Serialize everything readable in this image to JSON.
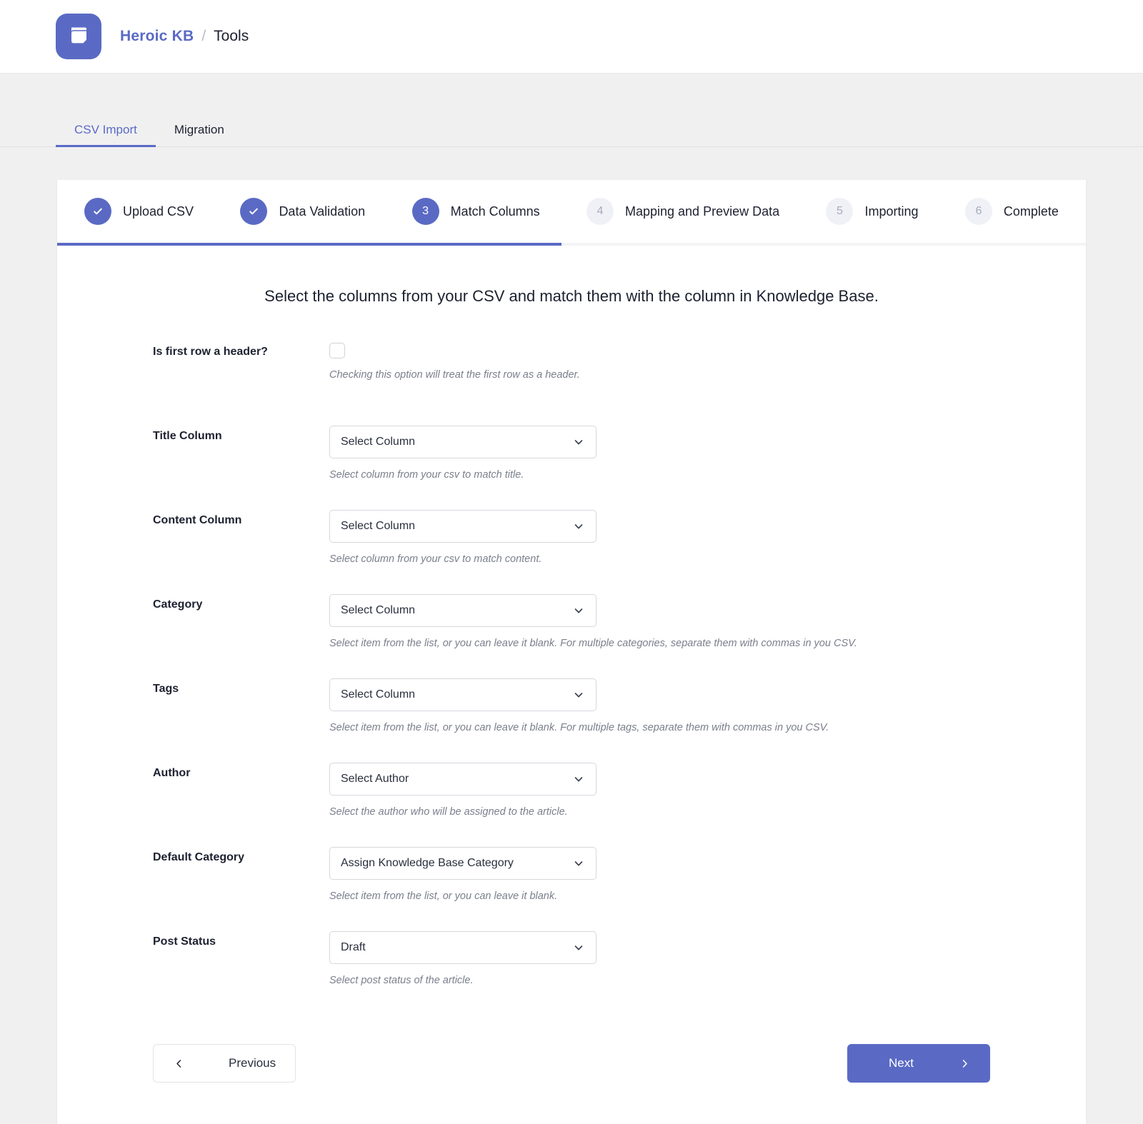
{
  "header": {
    "logo_icon": "book-icon",
    "brand": "Heroic KB",
    "separator": "/",
    "page": "Tools"
  },
  "tabs": [
    {
      "label": "CSV Import",
      "active": true
    },
    {
      "label": "Migration",
      "active": false
    }
  ],
  "stepper": {
    "progress_percent": 49,
    "steps": [
      {
        "num": "1",
        "label": "Upload CSV",
        "state": "done"
      },
      {
        "num": "2",
        "label": "Data Validation",
        "state": "done"
      },
      {
        "num": "3",
        "label": "Match Columns",
        "state": "current"
      },
      {
        "num": "4",
        "label": "Mapping and Preview Data",
        "state": "todo"
      },
      {
        "num": "5",
        "label": "Importing",
        "state": "todo"
      },
      {
        "num": "6",
        "label": "Complete",
        "state": "todo"
      }
    ]
  },
  "form": {
    "heading": "Select the columns from your CSV and match them with the column in Knowledge Base.",
    "rows": [
      {
        "label": "Is first row a header?",
        "control": "checkbox",
        "checked": false,
        "help": "Checking this option will treat the first row as a header."
      },
      {
        "label": "Title Column",
        "control": "select",
        "value": "Select Column",
        "help": "Select column from your csv to match title."
      },
      {
        "label": "Content Column",
        "control": "select",
        "value": "Select Column",
        "help": "Select column from your csv to match content."
      },
      {
        "label": "Category",
        "control": "select",
        "value": "Select Column",
        "help": "Select item from the list, or you can leave it blank. For multiple categories, separate them with commas in you CSV."
      },
      {
        "label": "Tags",
        "control": "select",
        "value": "Select Column",
        "help": "Select item from the list, or you can leave it blank. For multiple tags, separate them with commas in you CSV."
      },
      {
        "label": "Author",
        "control": "select",
        "value": "Select Author",
        "help": "Select the author who will be assigned to the article."
      },
      {
        "label": "Default Category",
        "control": "select",
        "value": "Assign Knowledge Base Category",
        "help": "Select item from the list, or you can leave it blank."
      },
      {
        "label": "Post Status",
        "control": "select",
        "value": "Draft",
        "help": "Select post status of the article."
      }
    ]
  },
  "footer": {
    "previous_label": "Previous",
    "next_label": "Next"
  },
  "colors": {
    "accent": "#5a6ac4",
    "page_bg": "#f0f0f1",
    "card_bg": "#ffffff",
    "text": "#1d2130",
    "muted": "#7b7f8c",
    "step_todo_bg": "#f0f1f6"
  }
}
